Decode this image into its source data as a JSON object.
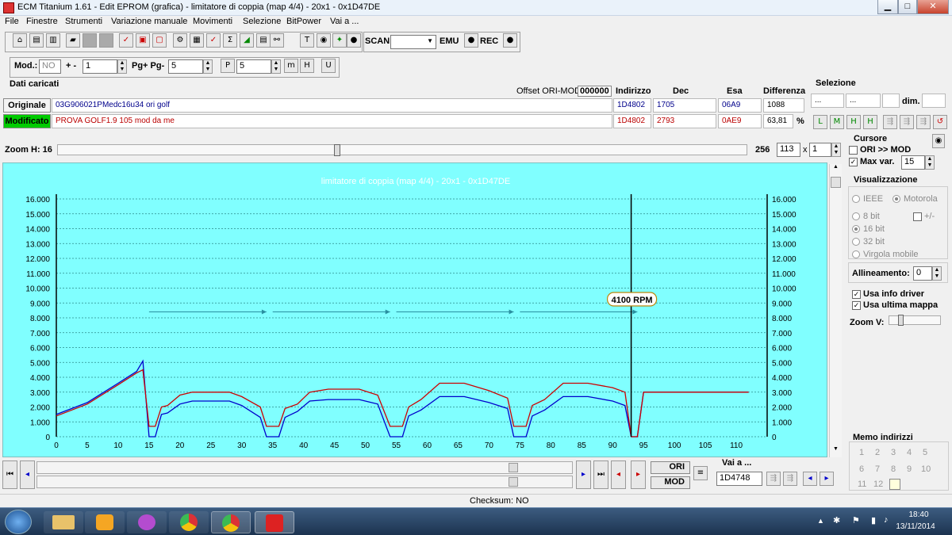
{
  "window": {
    "title": "ECM Titanium 1.61 - Edit EPROM (grafica) - limitatore di coppia (map 4/4) - 20x1 - 0x1D47DE",
    "min_label": "▁",
    "max_label": "□",
    "close_label": "✕"
  },
  "menu": [
    "File",
    "Finestre",
    "Strumenti",
    "Variazione manuale",
    "Movimenti",
    "Selezione",
    "BitPower",
    "Vai a ..."
  ],
  "toolbar": {
    "scan_label": "SCAN",
    "emu_label": "EMU",
    "rec_label": "REC",
    "mod_label": "Mod.:",
    "mod_value": "NO",
    "plusminus_label": "+ -",
    "plusminus_value": "1",
    "pg_label": "Pg+ Pg-",
    "pg_value": "5",
    "p_value": "5"
  },
  "dati": {
    "section_label": "Dati caricati",
    "offset_label": "Offset ORI-MOD",
    "offset_value": "000000",
    "col_indirizzo": "Indirizzo",
    "col_dec": "Dec",
    "col_esa": "Esa",
    "col_diff": "Differenza",
    "originale": {
      "label": "Originale",
      "name": "03G906021PMedc16u34 ori golf",
      "indirizzo": "1D4802",
      "dec": "1705",
      "esa": "06A9",
      "diff": "1088"
    },
    "modificato": {
      "label": "Modificato",
      "name": "PROVA GOLF1.9 105 mod da me",
      "indirizzo": "1D4802",
      "dec": "2793",
      "esa": "0AE9",
      "diff": "63,81",
      "unit": "%"
    }
  },
  "selezione": {
    "label": "Selezione",
    "f1": "...",
    "f2": "...",
    "dim_label": "dim."
  },
  "zoom": {
    "label": "Zoom H: 16",
    "value_256": "256",
    "cols": "113",
    "x_label": "x",
    "rows": "1"
  },
  "cursore": {
    "label": "Cursore",
    "ori_mod": "ORI >> MOD",
    "maxvar_label": "Max var.",
    "maxvar_value": "15"
  },
  "vis": {
    "label": "Visualizzazione",
    "ieee": "IEEE",
    "motorola": "Motorola",
    "b8": "8 bit",
    "pm": "+/-",
    "b16": "16 bit",
    "b32": "32 bit",
    "virgola": "Virgola mobile",
    "allineamento_label": "Allineamento:",
    "allineamento_value": "0",
    "info_driver": "Usa info driver",
    "ultima_mappa": "Usa ultima mappa",
    "zoomv_label": "Zoom V:"
  },
  "memo": {
    "label": "Memo indirizzi",
    "nums": [
      "1",
      "2",
      "3",
      "4",
      "5",
      "6",
      "7",
      "8",
      "9",
      "10",
      "11",
      "12"
    ]
  },
  "nav": {
    "ori_label": "ORI",
    "mod_label": "MOD",
    "vai_label": "Vai a ...",
    "vai_value": "1D4748"
  },
  "status": {
    "text": "Checksum: NO"
  },
  "taskbar": {
    "time": "18:40",
    "date": "13/11/2014"
  },
  "colors": {
    "chart_bg": "#80ffff",
    "ori_line": "#0000cc",
    "mod_line": "#cc0000",
    "arrow": "#2a8fa0",
    "modificato_bg": "#00cc00"
  },
  "chart_data": {
    "type": "line",
    "title": "limitatore di coppia (map 4/4) - 20x1 - 0x1D47DE",
    "xlim": [
      0,
      115
    ],
    "ylim": [
      0,
      16000
    ],
    "x_ticks": [
      0,
      5,
      10,
      15,
      20,
      25,
      30,
      35,
      40,
      45,
      50,
      55,
      60,
      65,
      70,
      75,
      80,
      85,
      90,
      95,
      100,
      105,
      110
    ],
    "y_ticks": [
      "0",
      "1.000",
      "2.000",
      "3.000",
      "4.000",
      "5.000",
      "6.000",
      "7.000",
      "8.000",
      "9.000",
      "10.000",
      "11.000",
      "12.000",
      "13.000",
      "14.000",
      "15.000",
      "16.000"
    ],
    "cursor": {
      "x": 93,
      "label": "4100 RPM"
    },
    "series": [
      {
        "color": "#0000cc",
        "points": [
          [
            0,
            1500
          ],
          [
            5,
            2300
          ],
          [
            10,
            3600
          ],
          [
            13,
            4400
          ],
          [
            14,
            5100
          ],
          [
            15,
            0
          ],
          [
            16,
            0
          ],
          [
            17,
            1500
          ],
          [
            18,
            1600
          ],
          [
            20,
            2200
          ],
          [
            22,
            2400
          ],
          [
            28,
            2400
          ],
          [
            30,
            2100
          ],
          [
            33,
            1300
          ],
          [
            34,
            0
          ],
          [
            36,
            0
          ],
          [
            37,
            1300
          ],
          [
            39,
            1700
          ],
          [
            41,
            2400
          ],
          [
            44,
            2500
          ],
          [
            49,
            2500
          ],
          [
            52,
            2200
          ],
          [
            54,
            0
          ],
          [
            56,
            0
          ],
          [
            57,
            1400
          ],
          [
            59,
            1800
          ],
          [
            62,
            2700
          ],
          [
            66,
            2700
          ],
          [
            70,
            2300
          ],
          [
            73,
            1900
          ],
          [
            74,
            0
          ],
          [
            76,
            0
          ],
          [
            77,
            1400
          ],
          [
            79,
            1800
          ],
          [
            82,
            2700
          ],
          [
            86,
            2700
          ],
          [
            90,
            2400
          ],
          [
            92,
            2100
          ],
          [
            93,
            0
          ],
          [
            94,
            0
          ],
          [
            95,
            3000
          ],
          [
            112,
            3000
          ]
        ]
      },
      {
        "color": "#cc0000",
        "points": [
          [
            0,
            1400
          ],
          [
            5,
            2200
          ],
          [
            10,
            3500
          ],
          [
            13,
            4300
          ],
          [
            14,
            4500
          ],
          [
            15,
            700
          ],
          [
            16,
            700
          ],
          [
            17,
            2000
          ],
          [
            18,
            2100
          ],
          [
            20,
            2800
          ],
          [
            22,
            3000
          ],
          [
            28,
            3000
          ],
          [
            30,
            2700
          ],
          [
            33,
            2000
          ],
          [
            34,
            700
          ],
          [
            36,
            700
          ],
          [
            37,
            1900
          ],
          [
            39,
            2200
          ],
          [
            41,
            3000
          ],
          [
            44,
            3200
          ],
          [
            49,
            3200
          ],
          [
            52,
            2800
          ],
          [
            54,
            700
          ],
          [
            56,
            700
          ],
          [
            57,
            2000
          ],
          [
            59,
            2500
          ],
          [
            62,
            3600
          ],
          [
            66,
            3600
          ],
          [
            70,
            3100
          ],
          [
            73,
            2600
          ],
          [
            74,
            700
          ],
          [
            76,
            700
          ],
          [
            77,
            2100
          ],
          [
            79,
            2500
          ],
          [
            82,
            3600
          ],
          [
            86,
            3600
          ],
          [
            90,
            3300
          ],
          [
            92,
            3000
          ],
          [
            93,
            0
          ],
          [
            94,
            0
          ],
          [
            95,
            3000
          ],
          [
            112,
            3000
          ]
        ]
      }
    ]
  }
}
